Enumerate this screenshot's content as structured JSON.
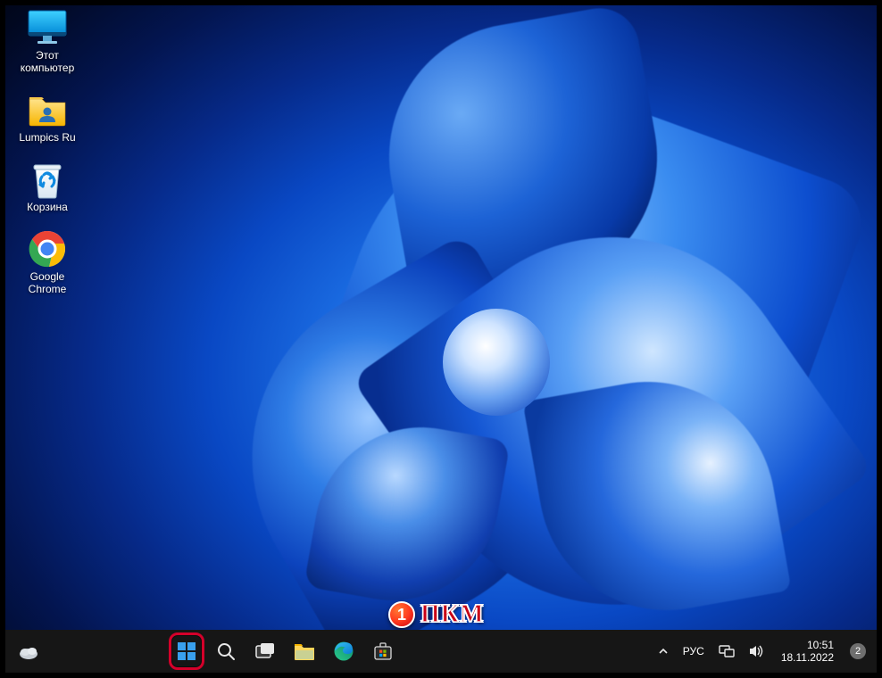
{
  "desktop_icons": [
    {
      "id": "this-pc",
      "label": "Этот\nкомпьютер"
    },
    {
      "id": "lumpics",
      "label": "Lumpics Ru"
    },
    {
      "id": "recycle",
      "label": "Корзина"
    },
    {
      "id": "chrome",
      "label": "Google\nChrome"
    }
  ],
  "annotation": {
    "number": "1",
    "text": "ПКМ"
  },
  "tray": {
    "language": "РУС",
    "time": "10:51",
    "date": "18.11.2022",
    "notifications": "2"
  }
}
